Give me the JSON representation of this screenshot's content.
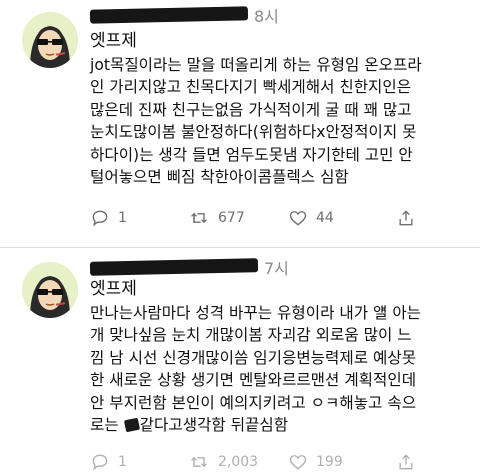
{
  "tweets": [
    {
      "time": "8시",
      "author": "엣프제",
      "lines": [
        "jot목질이라는 말을 떠올리게 하는 유형임 온오프라",
        "인 가리지않고 친목다지기 빡세게해서 친한지인은",
        "많은데 진짜 친구는없음 가식적이게 굴 때 꽤 많고",
        "눈치도많이봄 불안정하다(위험하다x안정적이지 못",
        "하다이)는 생각 들면 엄두도못냄 자기한테 고민 안",
        "털어놓으면 삐짐 착한아이콤플렉스 심함"
      ],
      "counts": {
        "replies": "1",
        "retweets": "677",
        "likes": "44"
      }
    },
    {
      "time": "7시",
      "author": "엣프제",
      "lines": [
        "만나는사람마다 성격 바꾸는 유형이라 내가 얠 아는",
        "개 맞나싶음 눈치 개많이봄 자괴감 외로움 많이 느",
        "낌 남 시선 신경개많이씀 임기응변능력제로 예상못",
        "한 새로운 상황 생기면 멘탈와르르맨션 계획적인데",
        "안 부지런함 본인이 예의지키려고 ㅇㅋ해놓고 속으",
        [
          "로는 ",
          "같다고생각함 뒤끝심함"
        ]
      ],
      "counts": {
        "replies": "1",
        "retweets": "2,003",
        "likes": "199"
      }
    }
  ],
  "colors": {
    "text": "#111111",
    "muted": "#6e6e6e",
    "avatar_bg": "#e8f0c8"
  },
  "icons": {
    "reply": "speech-bubble-icon",
    "retweet": "retweet-arrows-icon",
    "like": "heart-icon",
    "share": "share-icon"
  }
}
